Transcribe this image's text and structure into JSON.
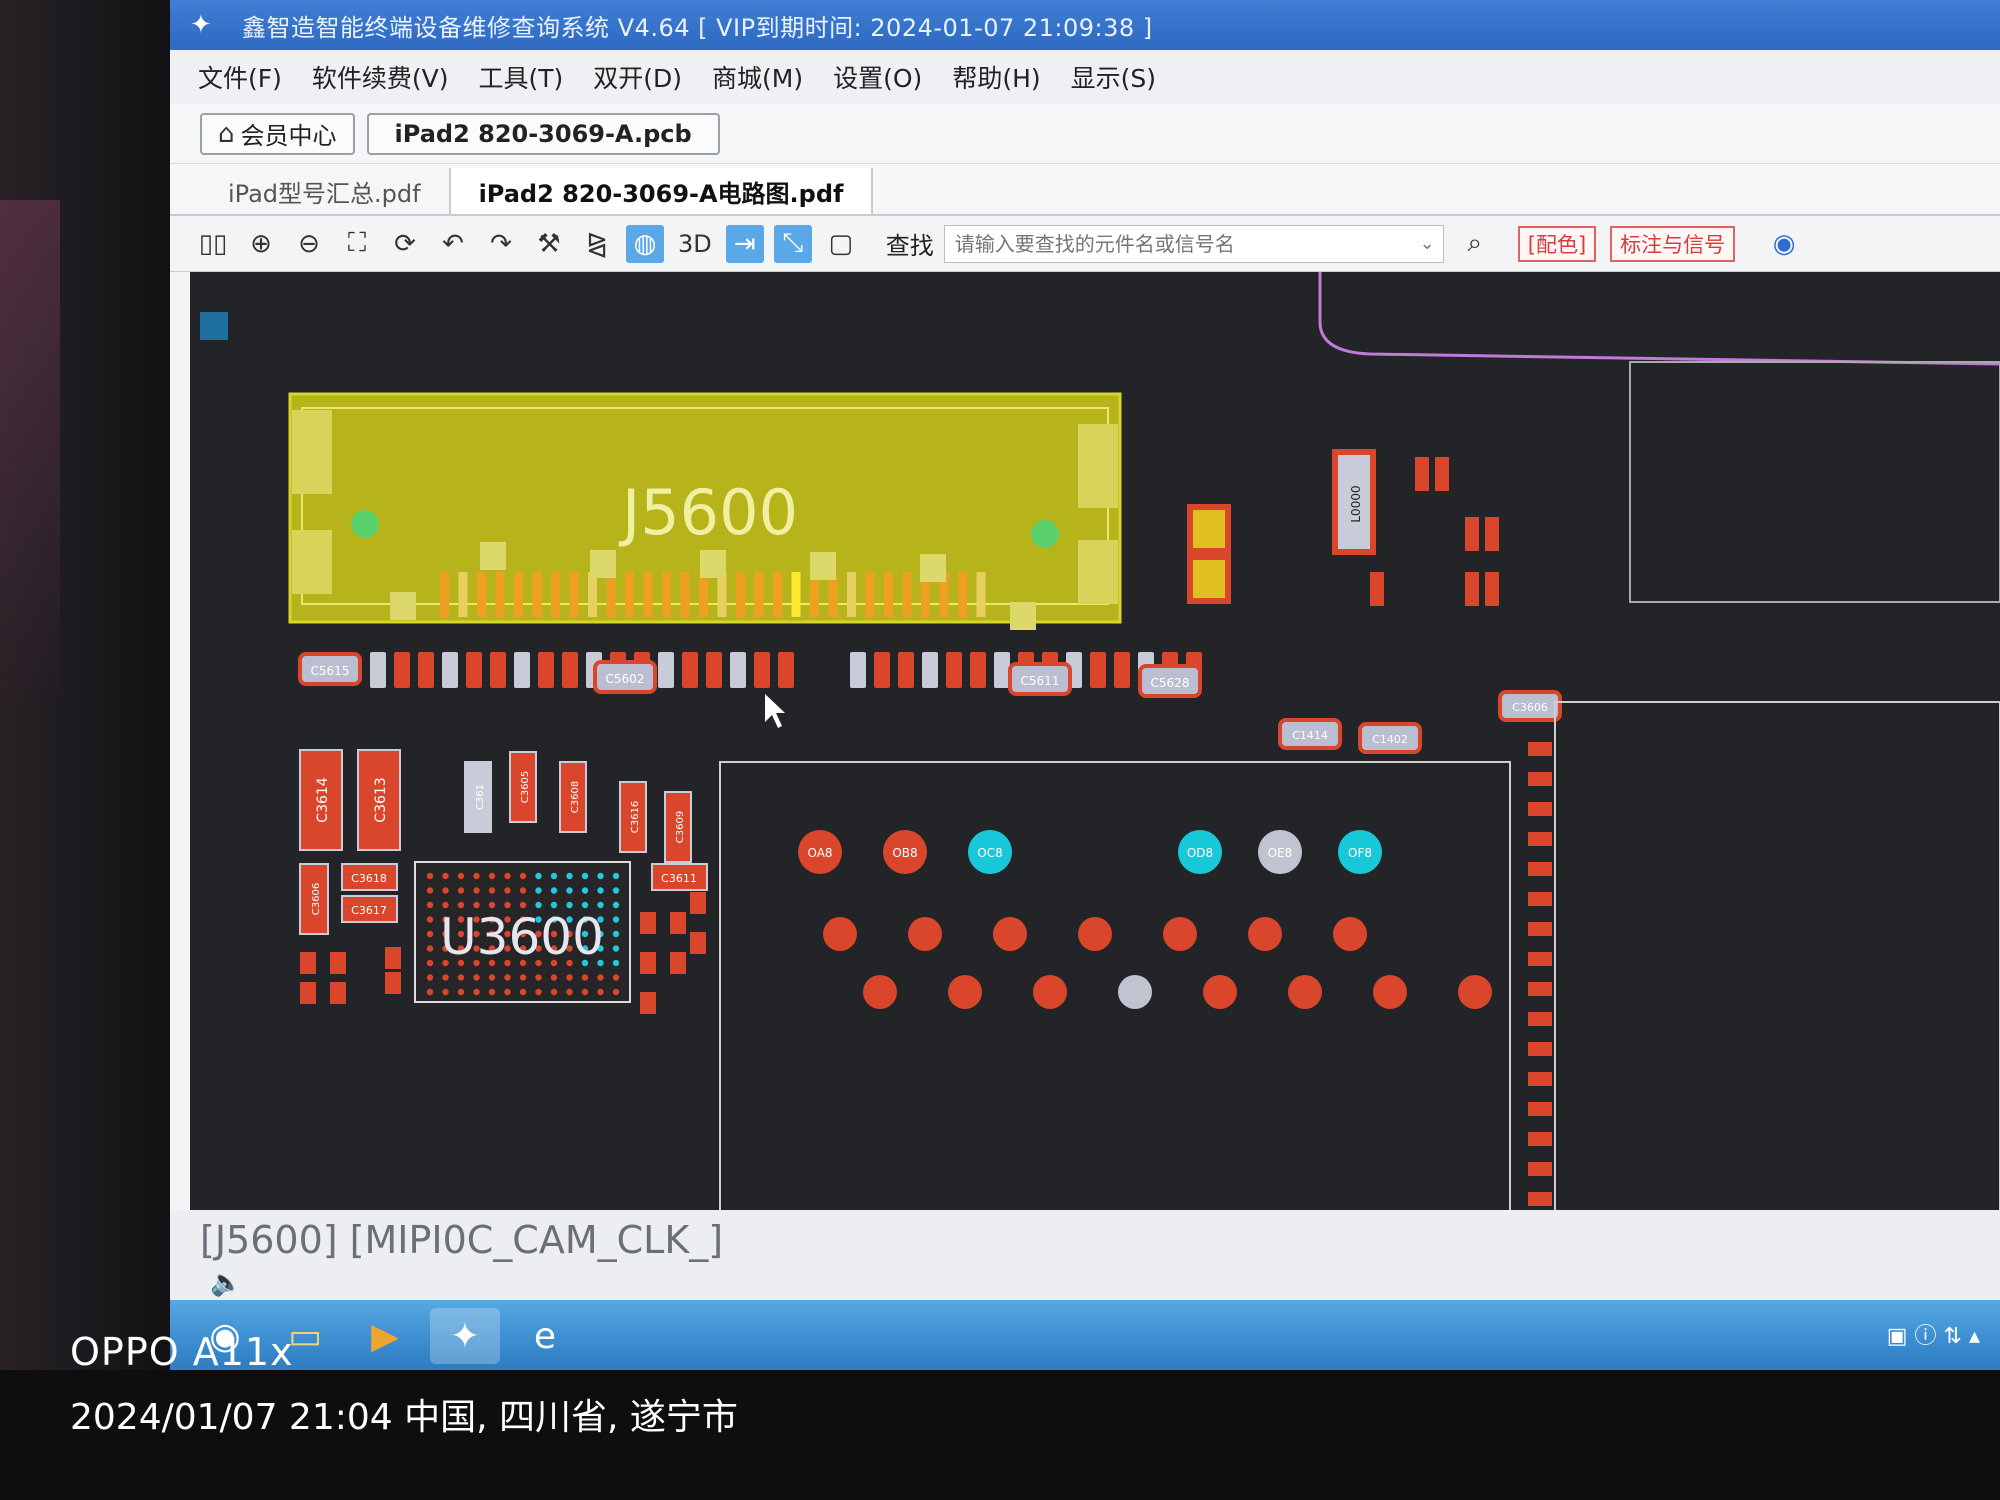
{
  "window": {
    "title": "鑫智造智能终端设备维修查询系统 V4.64 [ VIP到期时间: 2024-01-07 21:09:38 ]"
  },
  "menu": [
    {
      "label": "文件(F)"
    },
    {
      "label": "软件续费(V)"
    },
    {
      "label": "工具(T)"
    },
    {
      "label": "双开(D)"
    },
    {
      "label": "商城(M)"
    },
    {
      "label": "设置(O)"
    },
    {
      "label": "帮助(H)"
    },
    {
      "label": "显示(S)"
    }
  ],
  "top_tabs": {
    "member_center": "会员中心",
    "pcb_file": "iPad2 820-3069-A.pcb"
  },
  "doc_tabs": [
    {
      "label": "iPad型号汇总.pdf"
    },
    {
      "label": "iPad2 820-3069-A电路图.pdf"
    }
  ],
  "toolbar": {
    "three_d_label": "3D",
    "find_label": "查找",
    "search_placeholder": "请输入要查找的元件名或信号名",
    "color_button": "[配色]",
    "mark_signal_button": "标注与信号"
  },
  "board": {
    "connector_label": "J5600",
    "chip_label": "U3600",
    "components": [
      {
        "label": "C5615"
      },
      {
        "label": "C5602"
      },
      {
        "label": "C5611"
      },
      {
        "label": "C5628"
      },
      {
        "label": "C3614"
      },
      {
        "label": "C3613"
      },
      {
        "label": "C361"
      },
      {
        "label": "C3605"
      },
      {
        "label": "C3608"
      },
      {
        "label": "C3616"
      },
      {
        "label": "C3609"
      },
      {
        "label": "C3618"
      },
      {
        "label": "C3617"
      },
      {
        "label": "C3611"
      },
      {
        "label": "C3606"
      },
      {
        "label": "C1414"
      },
      {
        "label": "C1402"
      },
      {
        "label": "L0000"
      },
      {
        "label": "C5630"
      }
    ],
    "pads": [
      {
        "label": "OA8"
      },
      {
        "label": "OB8"
      },
      {
        "label": "OC8"
      },
      {
        "label": "OD8"
      },
      {
        "label": "OE8"
      },
      {
        "label": "OF8"
      }
    ]
  },
  "status": {
    "selection": "[J5600] [MIPI0C_CAM_CLK_]"
  },
  "watermark": {
    "device": "OPPO A11x",
    "info": "2024/01/07 21:04  中国, 四川省, 遂宁市"
  },
  "colors": {
    "titlebar": "#2e69c2",
    "canvas": "#232428",
    "connector": "#b8b81a",
    "component_red": "#d9462b",
    "pad_cyan": "#19c8d8"
  }
}
